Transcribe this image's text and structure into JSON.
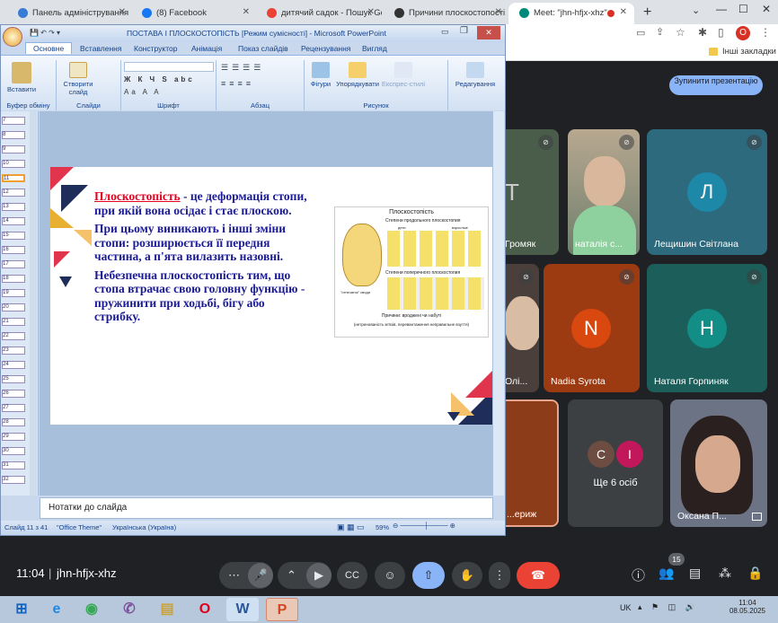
{
  "browser": {
    "tabs": [
      {
        "label": "Панель адміністрування",
        "fav": "#3a7bd5"
      },
      {
        "label": "(8) Facebook",
        "fav": "#1877f2"
      },
      {
        "label": "дитячий садок - Пошук Google",
        "fav": "#ea4335"
      },
      {
        "label": "Причини плоскостопості",
        "fav": "#333333"
      },
      {
        "label": "Meet: \"jhn-hfjx-xhz\"",
        "fav": "#00897b"
      }
    ],
    "bookmarks_label": "Інші закладки",
    "avatar_letter": "О"
  },
  "meet": {
    "present_button": "Зупинити презентацію",
    "participants": [
      {
        "label": "Т",
        "name": "Громяк"
      },
      {
        "label": "",
        "name": "наталія с..."
      },
      {
        "label": "Л",
        "name": "Лещишин Світлана"
      },
      {
        "label": "",
        "name": "Олі..."
      },
      {
        "label": "N",
        "name": "Nadia Syrota"
      },
      {
        "label": "Н",
        "name": "Наталя Горпиняк"
      },
      {
        "label": "",
        "name": "...ериж"
      },
      {
        "label": "С",
        "name": ""
      },
      {
        "label": "І",
        "name": ""
      },
      {
        "label": "",
        "name": "Оксана П..."
      }
    ],
    "more_label": "Ще 6 осіб",
    "clock": "11:04",
    "meeting_code": "jhn-hfjx-xhz",
    "badge": "15"
  },
  "ppt": {
    "title": "ПОСТАВА І ПЛОСКОСТОПІСТЬ [Режим сумісності] - Microsoft PowerPoint",
    "tabs": [
      "Основне",
      "Вставлення",
      "Конструктор",
      "Анімація",
      "Показ слайдів",
      "Рецензування",
      "Вигляд"
    ],
    "groups": [
      "Буфер обміну",
      "Слайди",
      "Шрифт",
      "Абзац",
      "Рисунок"
    ],
    "buttons": [
      "Вставити",
      "Створити слайд",
      "Фігури",
      "Упорядкувати",
      "Експрес-стилі",
      "Редагування"
    ],
    "slide": {
      "term": "Плоскостопість",
      "p1": " - це деформація стопи, при якій вона осідає і стає плоскою.",
      "p2": "При цьому виникають і інші зміни стопи: розширюється її передня частина, а п'ята вилазить назовні.",
      "p3": "Небезпечна плоскостопість тим, що стопа втрачає свою головну функцію - пружинити при ходьбі, бігу або стрибку.",
      "img_title": "Плоскостопість",
      "img_sub1": "Степени продольного плоскостопия",
      "img_sub2": "Степени поперечного плоскостопия",
      "img_cap1": "Причини: вроджені чи набуті",
      "img_cap2": "(нетренованість м'язів, перевантаження неправильне взуття)",
      "img_small1": "дети",
      "img_small2": "взрослые",
      "img_small3": "\"отпечаток\" свода"
    },
    "notes": "Нотатки до слайда",
    "status": {
      "slide": "Слайд 11 з 41",
      "theme": "\"Office Theme\"",
      "lang": "Українська (Україна)",
      "zoom": "59%"
    }
  },
  "taskbar": {
    "lang": "UK",
    "time": "11:04",
    "date": "08.05.2025"
  }
}
